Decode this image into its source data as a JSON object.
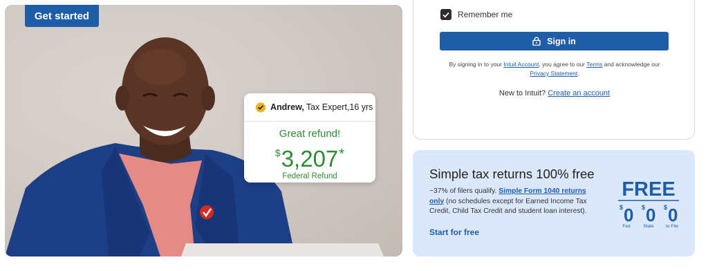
{
  "hero": {
    "get_started_label": "Get started",
    "refund_card": {
      "expert_name": "Andrew,",
      "expert_title": "Tax Expert,",
      "expert_years": "16 yrs",
      "headline": "Great refund!",
      "currency_symbol": "$",
      "amount": "3,207",
      "footnote_mark": "*",
      "refund_type": "Federal Refund"
    }
  },
  "signin": {
    "remember_label": "Remember me",
    "remember_checked": true,
    "button_label": "Sign in",
    "legal": {
      "prefix": "By signing in to your ",
      "account_link": "Intuit Account",
      "middle": ", you agree to our ",
      "terms_link": "Terms",
      "and_text": " and acknowledge our ",
      "privacy_link": "Privacy Statement",
      "end": "."
    },
    "new_text": "New to Intuit? ",
    "create_account_link": "Create an account"
  },
  "promo": {
    "title": "Simple tax returns 100% free",
    "desc_prefix": "~37% of filers qualify. ",
    "desc_link": "Simple Form 1040 returns only",
    "desc_suffix": " (no schedules except for Earned Income Tax Credit, Child Tax Credit and student loan interest).",
    "start_link": "Start for free",
    "graphic": {
      "headline": "FREE",
      "currency_symbol": "$",
      "amount": "0",
      "labels": [
        "Fed",
        "State",
        "to File"
      ]
    }
  },
  "colors": {
    "brand_blue": "#1f5da8",
    "refund_green": "#2f8a34",
    "promo_bg": "#dbe8fb"
  },
  "icons": {
    "badge": "verified-badge-icon",
    "lock": "lock-icon",
    "checkbox": "checkmark-icon"
  }
}
